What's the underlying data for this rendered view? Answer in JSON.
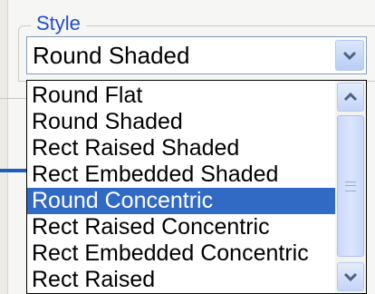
{
  "style_group": {
    "legend": "Style",
    "combo": {
      "selected_value": "Round Shaded"
    },
    "dropdown": {
      "items": [
        "Round Flat",
        "Round Shaded",
        "Rect Raised Shaded",
        "Rect Embedded Shaded",
        "Round Concentric",
        "Rect Raised Concentric",
        "Rect Embedded Concentric",
        "Rect Raised"
      ],
      "highlighted_item": "Round Concentric"
    }
  },
  "icons": {
    "combo_arrow": "chevron-down-icon",
    "scroll_up": "chevron-up-icon",
    "scroll_down": "chevron-down-icon",
    "scroll_grip": "grip-icon"
  },
  "colors": {
    "legend_text": "#1f4fcc",
    "selection": "#316ac5",
    "combo_border": "#7f9db9"
  }
}
